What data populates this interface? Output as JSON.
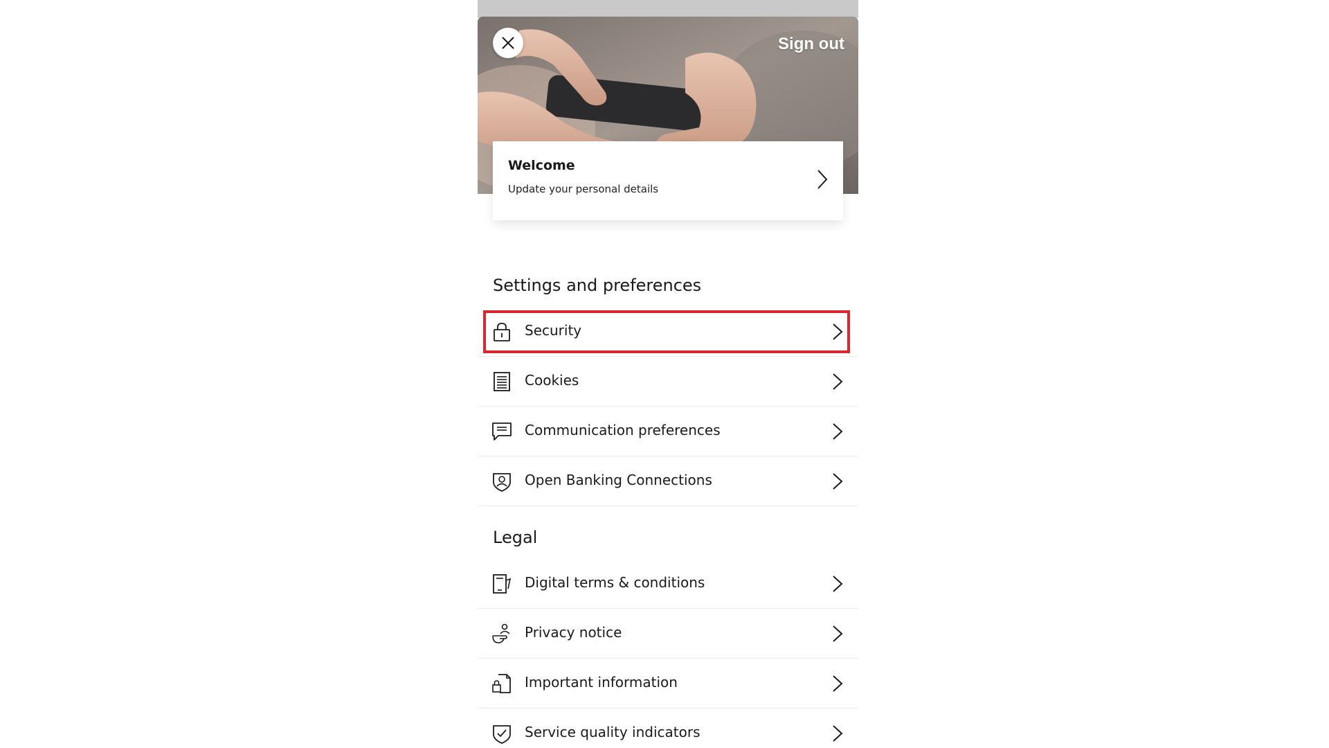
{
  "header": {
    "sign_out_label": "Sign out",
    "close_icon": "close-icon"
  },
  "welcome_card": {
    "title": "Welcome",
    "subtitle": "Update your personal details"
  },
  "sections": [
    {
      "title": "Settings and preferences",
      "items": [
        {
          "label": "Security",
          "icon": "padlock-icon",
          "highlighted": true
        },
        {
          "label": "Cookies",
          "icon": "document-list-icon"
        },
        {
          "label": "Communication preferences",
          "icon": "chat-bubble-icon"
        },
        {
          "label": "Open Banking Connections",
          "icon": "shield-person-icon"
        }
      ]
    },
    {
      "title": "Legal",
      "items": [
        {
          "label": "Digital terms & conditions",
          "icon": "mobile-document-icon"
        },
        {
          "label": "Privacy notice",
          "icon": "hand-person-icon"
        },
        {
          "label": "Important information",
          "icon": "locked-document-icon"
        },
        {
          "label": "Service quality indicators",
          "icon": "shield-check-icon"
        }
      ]
    }
  ],
  "colors": {
    "highlight": "#d7282f",
    "text": "#1a1a1a"
  }
}
